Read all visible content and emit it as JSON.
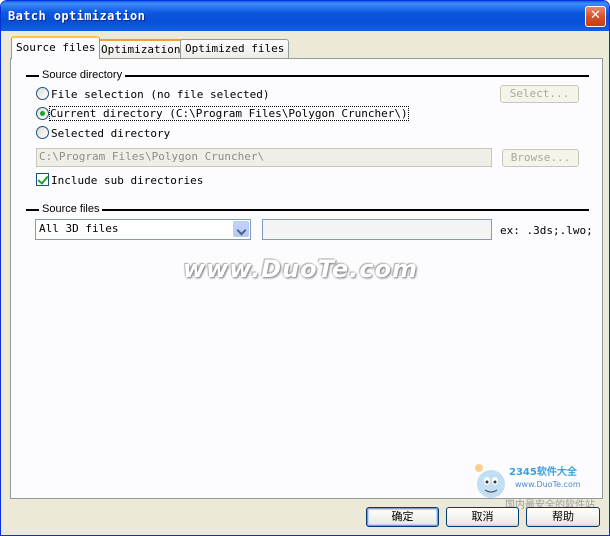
{
  "window": {
    "title": "Batch optimization",
    "close_label": "✕"
  },
  "tabs": [
    {
      "label": "Source files",
      "active": true
    },
    {
      "label": "Optimization",
      "active": false
    },
    {
      "label": "Optimized files",
      "active": false
    }
  ],
  "source_directory": {
    "group_label": "Source directory",
    "options": [
      {
        "label": "File selection (no file selected)",
        "checked": false
      },
      {
        "label": "Current directory (C:\\Program Files\\Polygon Cruncher\\)",
        "checked": true
      },
      {
        "label": "Selected directory",
        "checked": false
      }
    ],
    "select_button": "Select...",
    "path_value": "C:\\Program Files\\Polygon Cruncher\\",
    "browse_button": "Browse...",
    "include_sub": {
      "label": "Include sub directories",
      "checked": true
    }
  },
  "source_files": {
    "group_label": "Source files",
    "filter_selected": "All 3D files",
    "extensions_value": "",
    "extensions_hint": "ex: .3ds;.lwo;"
  },
  "watermark": "www.DuoTe.com",
  "logo": {
    "line1": "2345软件大全",
    "line2": "www.DuoTe.com",
    "line3": "国内最安全的软件站"
  },
  "footer": {
    "ok": "确定",
    "cancel": "取消",
    "help": "帮助"
  },
  "colors": {
    "titlebar": "#0a4fd6",
    "tab_highlight": "#ffc83c",
    "radio_dot": "#21a121",
    "dialog_bg": "#ece9d8"
  }
}
